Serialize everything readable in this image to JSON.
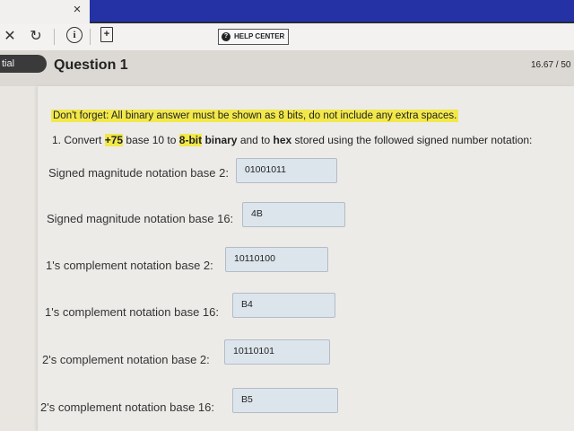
{
  "browser": {
    "tab_close_glyph": "×",
    "help_label": "HELP CENTER"
  },
  "toolbar": {
    "close_glyph": "✕",
    "refresh_glyph": "↻",
    "info_glyph": "i",
    "page_glyph": "+"
  },
  "question": {
    "side_label": "tial",
    "title": "Question 1",
    "score": "16.67 / 50",
    "notice": "Don't forget: All binary answer must be shown as 8 bits, do not include any extra spaces.",
    "prompt": {
      "p1": "1. Convert ",
      "num": "+75",
      "p2": " base 10 to ",
      "bits": "8-bit",
      "p3": " ",
      "binary": "binary",
      "p4": " and to ",
      "hex": "hex",
      "p5": " stored using the followed signed number notation:"
    },
    "rows": [
      {
        "label": "Signed magnitude notation base 2:",
        "value": "01001011"
      },
      {
        "label": "Signed magnitude notation base 16:",
        "value": "4B"
      },
      {
        "label": "1's complement notation base 2:",
        "value": "10110100"
      },
      {
        "label": "1's complement notation base 16:",
        "value": "B4"
      },
      {
        "label": "2's complement notation base 2:",
        "value": "10110101"
      },
      {
        "label": "2's complement notation base 16:",
        "value": "B5"
      }
    ]
  },
  "colors": {
    "highlight": "#f2e84a",
    "accent_bar": "#2432a6",
    "input_bg": "#dde5ec"
  }
}
